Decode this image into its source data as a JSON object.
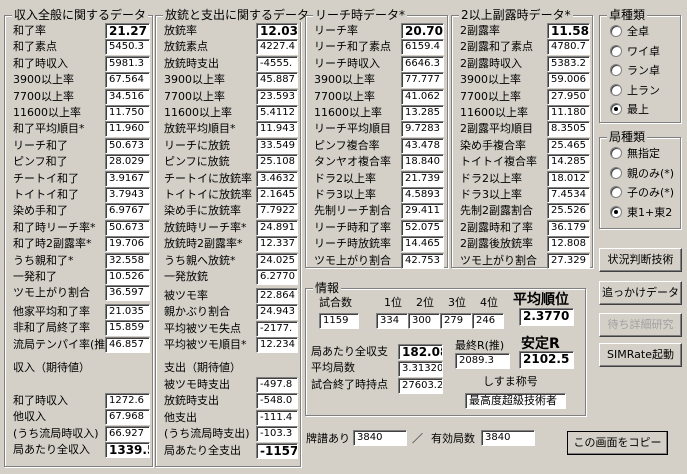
{
  "sections": {
    "income": {
      "title": "収入全般に関するデータ",
      "rows": [
        {
          "label": "和了率",
          "value": "21.27"
        },
        {
          "label": "和了素点",
          "value": "5450.3"
        },
        {
          "label": "和了時収入",
          "value": "5981.3"
        },
        {
          "label": "3900以上率",
          "value": "67.564"
        },
        {
          "label": "7700以上率",
          "value": "34.516"
        },
        {
          "label": "11600以上率",
          "value": "11.750"
        },
        {
          "label": "和了平均順目*",
          "value": "11.960"
        },
        {
          "label": "リーチ和了",
          "value": "50.673"
        },
        {
          "label": "ピンフ和了",
          "value": "28.029"
        },
        {
          "label": "チートイ和了",
          "value": "3.9167"
        },
        {
          "label": "トイトイ和了",
          "value": "3.7943"
        },
        {
          "label": "染め手和了",
          "value": "6.9767"
        },
        {
          "label": "和了時リーチ率*",
          "value": "50.673"
        },
        {
          "label": "和了時2副露率*",
          "value": "19.706"
        },
        {
          "label": "うち親和了*",
          "value": "32.558"
        },
        {
          "label": "一発和了",
          "value": "10.526"
        },
        {
          "label": "ツモ上がり割合",
          "value": "36.597"
        }
      ],
      "rows2": [
        {
          "label": "他家平均和了率",
          "value": "21.035"
        },
        {
          "label": "非和了局終了率",
          "value": "15.859"
        },
        {
          "label": "流局テンパイ率(推)",
          "value": "46.857"
        }
      ],
      "expected_title": "収入（期待値）",
      "rows3": [
        {
          "label": "和了時収入",
          "value": "1272.6"
        },
        {
          "label": "他収入",
          "value": "67.968"
        },
        {
          "label": "(うち流局時収入)",
          "value": "66.927"
        },
        {
          "label": "局あたり全収入",
          "value": "1339.5"
        }
      ]
    },
    "deal": {
      "title": "放銃と支出に関するデータ",
      "rows": [
        {
          "label": "放銃率",
          "value": "12.03"
        },
        {
          "label": "放銃素点",
          "value": "4227.4"
        },
        {
          "label": "放銃時支出",
          "value": "-4555."
        },
        {
          "label": "3900以上率",
          "value": "45.887"
        },
        {
          "label": "7700以上率",
          "value": "23.593"
        },
        {
          "label": "11600以上率",
          "value": "5.4112"
        },
        {
          "label": "放銃平均順目*",
          "value": "11.943"
        },
        {
          "label": "リーチに放銃",
          "value": "33.549"
        },
        {
          "label": "ピンフに放銃",
          "value": "25.108"
        },
        {
          "label": "チートイに放銃率",
          "value": "3.4632"
        },
        {
          "label": "トイトイに放銃率",
          "value": "2.1645"
        },
        {
          "label": "染め手に放銃率",
          "value": "7.7922"
        },
        {
          "label": "放銃時リーチ率*",
          "value": "24.891"
        },
        {
          "label": "放銃時2副露率*",
          "value": "12.337"
        },
        {
          "label": "うち親へ放銃*",
          "value": "24.025"
        },
        {
          "label": "一発放銃",
          "value": "6.2770"
        }
      ],
      "rows2": [
        {
          "label": "被ツモ率",
          "value": "22.864"
        },
        {
          "label": "親かぶり割合",
          "value": "24.943"
        },
        {
          "label": "平均被ツモ失点",
          "value": "-2177."
        },
        {
          "label": "平均被ツモ順目*",
          "value": "12.234"
        }
      ],
      "expected_title": "支出（期待値）",
      "rows3": [
        {
          "label": "被ツモ時支出",
          "value": "-497.8"
        },
        {
          "label": "放銃時支出",
          "value": "-548.0"
        },
        {
          "label": "他支出",
          "value": "-111.4"
        },
        {
          "label": "(うち流局時支出)",
          "value": "-103.3"
        },
        {
          "label": "局あたり全支出",
          "value": "-1157."
        }
      ]
    },
    "riichi": {
      "title": "リーチ時データ*",
      "rows": [
        {
          "label": "リーチ率",
          "value": "20.70"
        },
        {
          "label": "リーチ和了素点",
          "value": "6159.4"
        },
        {
          "label": "リーチ時収入",
          "value": "6646.3"
        },
        {
          "label": "3900以上率",
          "value": "77.777"
        },
        {
          "label": "7700以上率",
          "value": "41.062"
        },
        {
          "label": "11600以上率",
          "value": "13.285"
        },
        {
          "label": "リーチ平均順目",
          "value": "9.7283"
        },
        {
          "label": "ピンフ複合率",
          "value": "43.478"
        },
        {
          "label": "タンヤオ複合率",
          "value": "18.840"
        },
        {
          "label": "ドラ2以上率",
          "value": "21.739"
        },
        {
          "label": "ドラ3以上率",
          "value": "4.5893"
        },
        {
          "label": "先制リーチ割合",
          "value": "29.411"
        },
        {
          "label": "リーチ時和了率",
          "value": "52.075"
        },
        {
          "label": "リーチ時放銃率",
          "value": "14.465"
        },
        {
          "label": "ツモ上がり割合",
          "value": "42.753"
        }
      ]
    },
    "furo": {
      "title": "2以上副露時データ*",
      "rows": [
        {
          "label": "2副露率",
          "value": "11.58"
        },
        {
          "label": "2副露和了素点",
          "value": "4780.7"
        },
        {
          "label": "2副露時収入",
          "value": "5383.2"
        },
        {
          "label": "3900以上率",
          "value": "59.006"
        },
        {
          "label": "7700以上率",
          "value": "27.950"
        },
        {
          "label": "11600以上率",
          "value": "11.180"
        },
        {
          "label": "2副露平均順目",
          "value": "8.3505"
        },
        {
          "label": "染め手複合率",
          "value": "25.465"
        },
        {
          "label": "トイトイ複合率",
          "value": "14.285"
        },
        {
          "label": "ドラ2以上率",
          "value": "18.012"
        },
        {
          "label": "ドラ3以上率",
          "value": "7.4534"
        },
        {
          "label": "先制2副露割合",
          "value": "25.526"
        },
        {
          "label": "2副露時和了率",
          "value": "36.179"
        },
        {
          "label": "2副露後放銃率",
          "value": "12.808"
        },
        {
          "label": "ツモ上がり割合",
          "value": "27.329"
        }
      ]
    },
    "table_type": {
      "title": "卓種類",
      "options": [
        "全卓",
        "ワイ卓",
        "ラン卓",
        "上ラン",
        "最上"
      ],
      "selected": 4
    },
    "round_type": {
      "title": "局種類",
      "options": [
        "無指定",
        "親のみ(*)",
        "子のみ(*)",
        "東1+東2"
      ],
      "selected": 3
    },
    "info": {
      "title": "情報",
      "games_label": "試合数",
      "games_value": "1159",
      "place_labels": [
        "1位",
        "2位",
        "3位",
        "4位"
      ],
      "place_values": [
        "334",
        "300",
        "279",
        "246"
      ],
      "avg_rank_label": "平均順位",
      "avg_rank_value": "2.3770",
      "stable_label": "安定R",
      "stable_value": "2102.5",
      "income_label": "局あたり全収支",
      "income_value": "182.08",
      "avg_rounds_label": "平均局数",
      "avg_rounds_value": "3.31320",
      "final_points_label": "試合終了時持点",
      "final_points_value": "27603.2",
      "final_r_label": "最終R(推)",
      "final_r_value": "2089.3",
      "title_label": "しすま称号",
      "title_value": "最高度超級技術者"
    },
    "bottom": {
      "haifu_label": "牌譜あり",
      "haifu_value": "3840",
      "sep": "／",
      "valid_label": "有効局数",
      "valid_value": "3840"
    }
  },
  "buttons": {
    "situation": "状況判断技術",
    "chase": "追っかけデータ",
    "wait": "待ち詳細研究",
    "simrate": "SIMRate起動",
    "copy": "この画面をコピー"
  }
}
